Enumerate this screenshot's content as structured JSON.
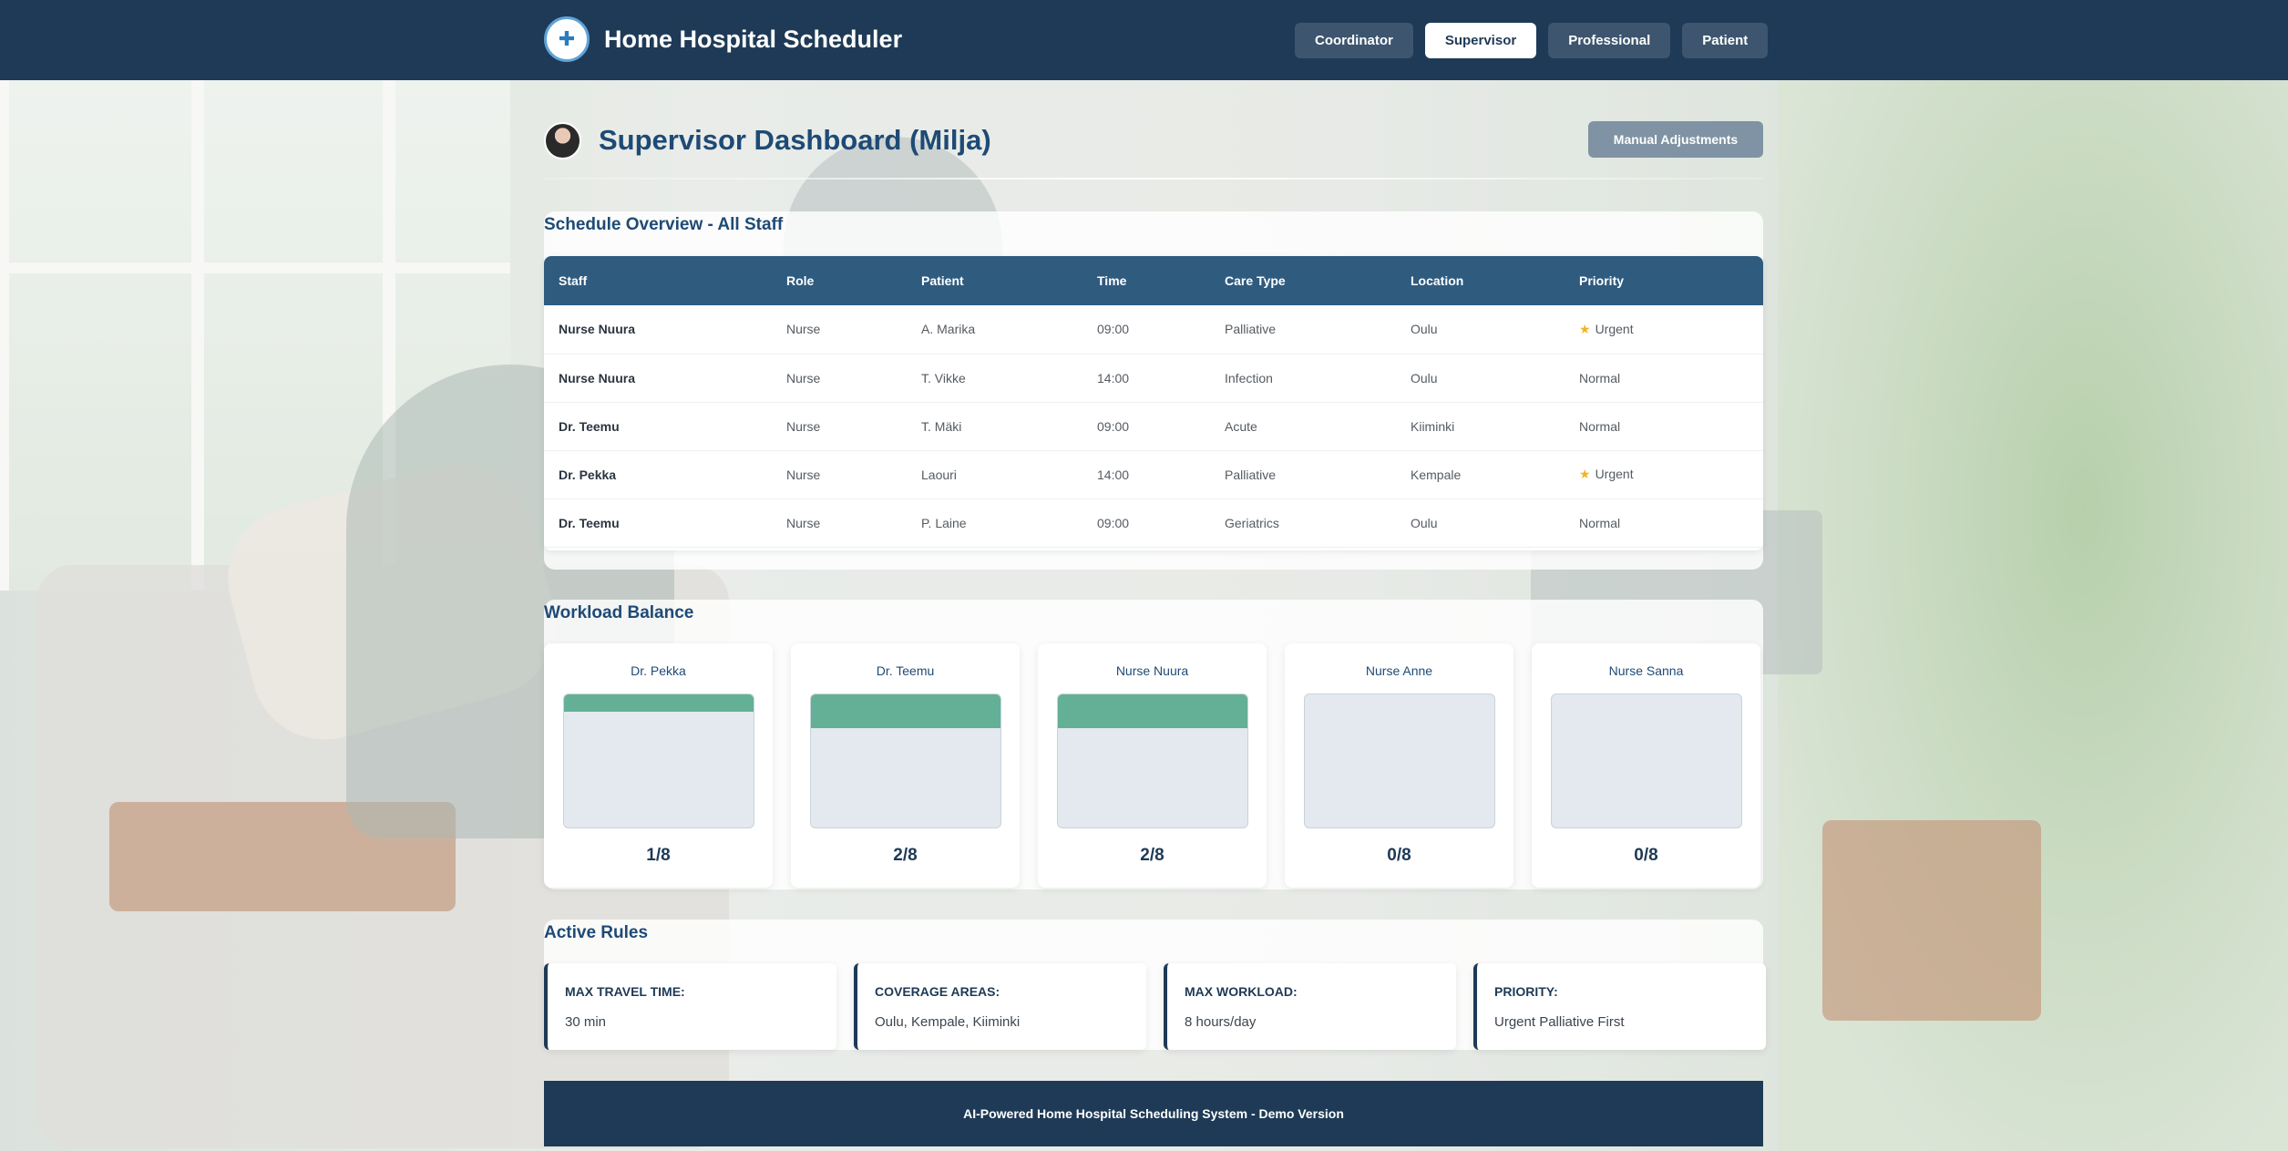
{
  "header": {
    "brand_title": "Home Hospital Scheduler",
    "nav": [
      {
        "label": "Coordinator",
        "active": false
      },
      {
        "label": "Supervisor",
        "active": true
      },
      {
        "label": "Professional",
        "active": false
      },
      {
        "label": "Patient",
        "active": false
      }
    ]
  },
  "page": {
    "title": "Supervisor Dashboard (Milja)",
    "manual_button": "Manual Adjustments"
  },
  "schedule": {
    "title": "Schedule Overview - All Staff",
    "columns": [
      "Staff",
      "Role",
      "Patient",
      "Time",
      "Care Type",
      "Location",
      "Priority"
    ],
    "rows": [
      {
        "staff": "Nurse Nuura",
        "role": "Nurse",
        "patient": "A. Marika",
        "time": "09:00",
        "care_type": "Palliative",
        "location": "Oulu",
        "priority": "Urgent",
        "urgent": true
      },
      {
        "staff": "Nurse Nuura",
        "role": "Nurse",
        "patient": "T. Vikke",
        "time": "14:00",
        "care_type": "Infection",
        "location": "Oulu",
        "priority": "Normal",
        "urgent": false
      },
      {
        "staff": "Dr. Teemu",
        "role": "Nurse",
        "patient": "T. Mäki",
        "time": "09:00",
        "care_type": "Acute",
        "location": "Kiiminki",
        "priority": "Normal",
        "urgent": false
      },
      {
        "staff": "Dr. Pekka",
        "role": "Nurse",
        "patient": "Laouri",
        "time": "14:00",
        "care_type": "Palliative",
        "location": "Kempale",
        "priority": "Urgent",
        "urgent": true
      },
      {
        "staff": "Dr. Teemu",
        "role": "Nurse",
        "patient": "P. Laine",
        "time": "09:00",
        "care_type": "Geriatrics",
        "location": "Oulu",
        "priority": "Normal",
        "urgent": false
      }
    ]
  },
  "workload": {
    "title": "Workload Balance",
    "staff": [
      {
        "name": "Dr. Pekka",
        "count": "1/8",
        "load": 0.125
      },
      {
        "name": "Dr. Teemu",
        "count": "2/8",
        "load": 0.25
      },
      {
        "name": "Nurse Nuura",
        "count": "2/8",
        "load": 0.25
      },
      {
        "name": "Nurse Anne",
        "count": "0/8",
        "load": 0
      },
      {
        "name": "Nurse Sanna",
        "count": "0/8",
        "load": 0
      }
    ]
  },
  "rules": {
    "title": "Active Rules",
    "items": [
      {
        "label": "MAX TRAVEL TIME:",
        "value": "30 min"
      },
      {
        "label": "COVERAGE AREAS:",
        "value": "Oulu, Kempale, Kiiminki"
      },
      {
        "label": "MAX WORKLOAD:",
        "value": "8 hours/day"
      },
      {
        "label": "PRIORITY:",
        "value": "Urgent Palliative First"
      }
    ]
  },
  "footer": {
    "text": "AI-Powered Home Hospital Scheduling System - Demo Version"
  },
  "colors": {
    "header_bg": "#1e3a56",
    "accent": "#2f5b7f",
    "workload_fill": "#64b096",
    "urgent_star": "#f0b429"
  }
}
